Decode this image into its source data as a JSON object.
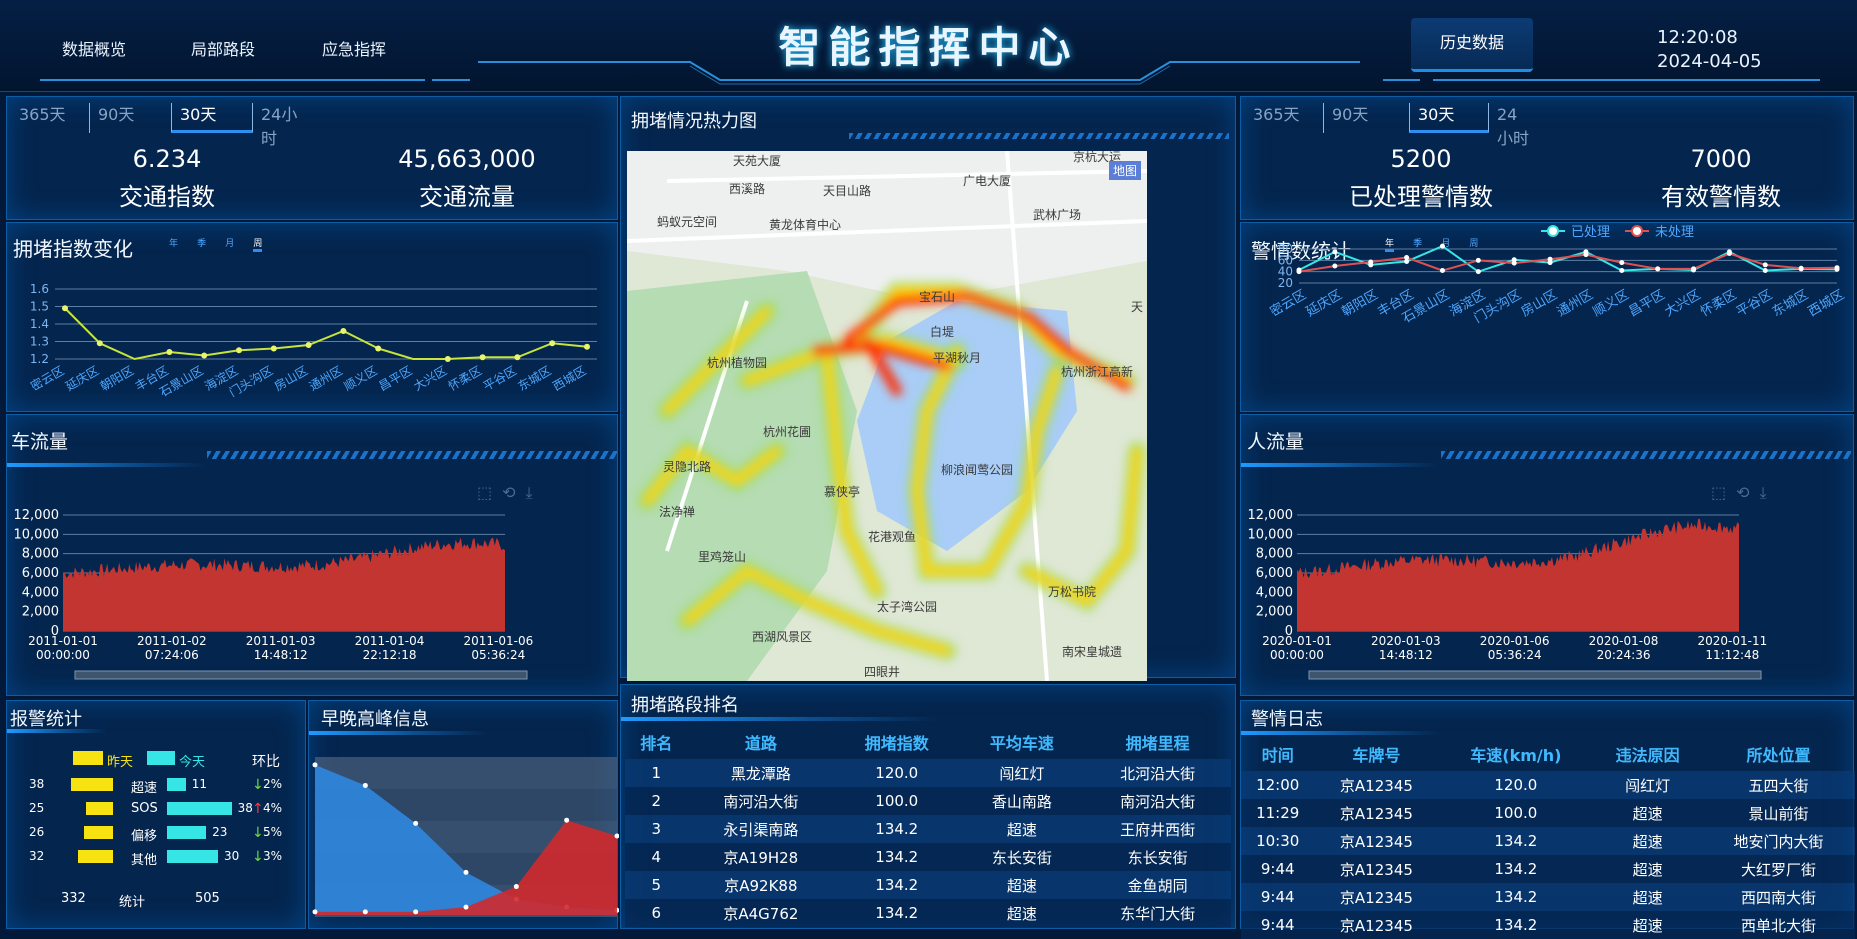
{
  "header": {
    "title": "智能指挥中心",
    "nav": [
      "数据概览",
      "局部路段",
      "应急指挥"
    ],
    "history_button": "历史数据",
    "time": "12:20:08",
    "date": "2024-04-05"
  },
  "range_tabs": [
    "365天",
    "90天",
    "30天",
    "24小时"
  ],
  "left_top": {
    "kpis": [
      {
        "value": "6.234",
        "label": "交通指数"
      },
      {
        "value": "45,663,000",
        "label": "交通流量"
      }
    ]
  },
  "congestion_chart": {
    "title": "拥堵指数变化",
    "period_tabs": [
      "年",
      "季",
      "月",
      "周"
    ]
  },
  "car_flow": {
    "title": "车流量"
  },
  "alarm_stats": {
    "title": "报警统计",
    "legend_yesterday": "昨天",
    "legend_today": "今天",
    "ratio_header": "环比",
    "rows": [
      {
        "label": "超速",
        "yesterday": "38",
        "today": "11",
        "ratio": "2%",
        "dir": "down"
      },
      {
        "label": "SOS",
        "yesterday": "25",
        "today": "38",
        "ratio": "4%",
        "dir": "up"
      },
      {
        "label": "偏移",
        "yesterday": "26",
        "today": "23",
        "ratio": "5%",
        "dir": "down"
      },
      {
        "label": "其他",
        "yesterday": "32",
        "today": "30",
        "ratio": "3%",
        "dir": "down"
      }
    ],
    "total_yesterday": "332",
    "total_label": "统计",
    "total_today": "505"
  },
  "peak": {
    "title": "早晚高峰信息"
  },
  "heatmap": {
    "title": "拥堵情况热力图",
    "map_badge": "地图",
    "places": [
      "天苑大厦",
      "西溪路",
      "天目山路",
      "广电大厦",
      "京杭大运",
      "蚂蚁元空间",
      "黄龙体育中心",
      "武林广场",
      "宝石山",
      "白堤",
      "平湖秋月",
      "杭州植物园",
      "杭州花圃",
      "杭州浙江高新",
      "柳浪闻莺公园",
      "灵隐北路",
      "慕侠亭",
      "法净禅",
      "花港观鱼",
      "里鸡笼山",
      "太子湾公园",
      "万松书院",
      "西湖风景区",
      "南宋皇城遗",
      "四眼井",
      "天"
    ]
  },
  "rank": {
    "title": "拥堵路段排名",
    "headers": [
      "排名",
      "道路",
      "拥堵指数",
      "平均车速",
      "拥堵里程"
    ],
    "rows": [
      [
        "1",
        "黑龙潭路",
        "120.0",
        "闯红灯",
        "北河沿大街"
      ],
      [
        "2",
        "南河沿大街",
        "100.0",
        "香山南路",
        "南河沿大街"
      ],
      [
        "3",
        "永引渠南路",
        "134.2",
        "超速",
        "王府井西街"
      ],
      [
        "4",
        "京A19H28",
        "134.2",
        "东长安街",
        "东长安街"
      ],
      [
        "5",
        "京A92K88",
        "134.2",
        "超速",
        "金鱼胡同"
      ],
      [
        "6",
        "京A4G762",
        "134.2",
        "超速",
        "东华门大街"
      ]
    ]
  },
  "right_top": {
    "kpis": [
      {
        "value": "5200",
        "label": "已处理警情数"
      },
      {
        "value": "7000",
        "label": "有效警情数"
      }
    ]
  },
  "alarm_count": {
    "title": "警情数统计",
    "period_tabs": [
      "年",
      "季",
      "月",
      "周"
    ],
    "legend": [
      "已处理",
      "未处理"
    ]
  },
  "people_flow": {
    "title": "人流量"
  },
  "log": {
    "title": "警情日志",
    "headers": [
      "时间",
      "车牌号",
      "车速(km/h)",
      "违法原因",
      "所处位置"
    ],
    "rows": [
      [
        "12:00",
        "京A12345",
        "120.0",
        "闯红灯",
        "五四大街"
      ],
      [
        "11:29",
        "京A12345",
        "100.0",
        "超速",
        "景山前街"
      ],
      [
        "10:30",
        "京A12345",
        "134.2",
        "超速",
        "地安门内大街"
      ],
      [
        "9:44",
        "京A12345",
        "134.2",
        "超速",
        "大红罗厂街"
      ],
      [
        "9:44",
        "京A12345",
        "134.2",
        "超速",
        "西四南大街"
      ],
      [
        "9:44",
        "京A12345",
        "134.2",
        "超速",
        "西单北大街"
      ]
    ]
  },
  "chart_data": [
    {
      "type": "line",
      "title": "拥堵指数变化",
      "categories": [
        "密云区",
        "延庆区",
        "朝阳区",
        "丰台区",
        "石景山区",
        "海淀区",
        "门头沟区",
        "房山区",
        "通州区",
        "顺义区",
        "昌平区",
        "大兴区",
        "怀柔区",
        "平谷区",
        "东城区",
        "西城区"
      ],
      "series": [
        {
          "values": [
            1.49,
            1.29,
            1.17,
            1.24,
            1.22,
            1.25,
            1.26,
            1.28,
            1.36,
            1.26,
            1.17,
            1.2,
            1.21,
            1.21,
            1.29,
            1.27
          ]
        }
      ],
      "ylim": [
        1.2,
        1.6
      ],
      "yticks": [
        "1.2",
        "1.3",
        "1.4",
        "1.5",
        "1.6"
      ]
    },
    {
      "type": "area",
      "title": "车流量",
      "x": [
        "2011-01-01 00:00:00",
        "2011-01-02 07:24:06",
        "2011-01-03 14:48:12",
        "2011-01-04 22:12:18",
        "2011-01-06 05:36:24"
      ],
      "yticks": [
        "0",
        "2,000",
        "4,000",
        "6,000",
        "8,000",
        "10,000",
        "12,000"
      ],
      "ylim": [
        0,
        12000
      ],
      "approx_range": [
        6000,
        9500
      ]
    },
    {
      "type": "area",
      "title": "早晚高峰信息",
      "series": [
        {
          "name": "blue",
          "values": [
            95,
            82,
            58,
            27,
            10,
            5,
            3
          ]
        },
        {
          "name": "red",
          "values": [
            2,
            2,
            2,
            5,
            18,
            60,
            50
          ]
        }
      ]
    },
    {
      "type": "line",
      "title": "警情数统计",
      "categories": [
        "密云区",
        "延庆区",
        "朝阳区",
        "丰台区",
        "石景山区",
        "海淀区",
        "门头沟区",
        "房山区",
        "通州区",
        "顺义区",
        "昌平区",
        "大兴区",
        "怀柔区",
        "平谷区",
        "东城区",
        "西城区"
      ],
      "series": [
        {
          "name": "已处理",
          "values": [
            43,
            75,
            52,
            58,
            85,
            40,
            61,
            56,
            75,
            42,
            45,
            43,
            75,
            42,
            45,
            44
          ]
        },
        {
          "name": "未处理",
          "values": [
            40,
            50,
            57,
            65,
            42,
            60,
            55,
            62,
            70,
            56,
            45,
            45,
            72,
            52,
            46,
            47
          ]
        }
      ],
      "ylim": [
        20,
        80
      ],
      "yticks": [
        "20",
        "40",
        "60",
        "80"
      ]
    },
    {
      "type": "area",
      "title": "人流量",
      "x": [
        "2020-01-01 00:00:00",
        "2020-01-03 14:48:12",
        "2020-01-06 05:36:24",
        "2020-01-08 20:24:36",
        "2020-01-11 11:12:48"
      ],
      "yticks": [
        "0",
        "2,000",
        "4,000",
        "6,000",
        "8,000",
        "10,000",
        "12,000"
      ],
      "ylim": [
        0,
        12000
      ],
      "approx_range": [
        6000,
        11500
      ]
    }
  ]
}
